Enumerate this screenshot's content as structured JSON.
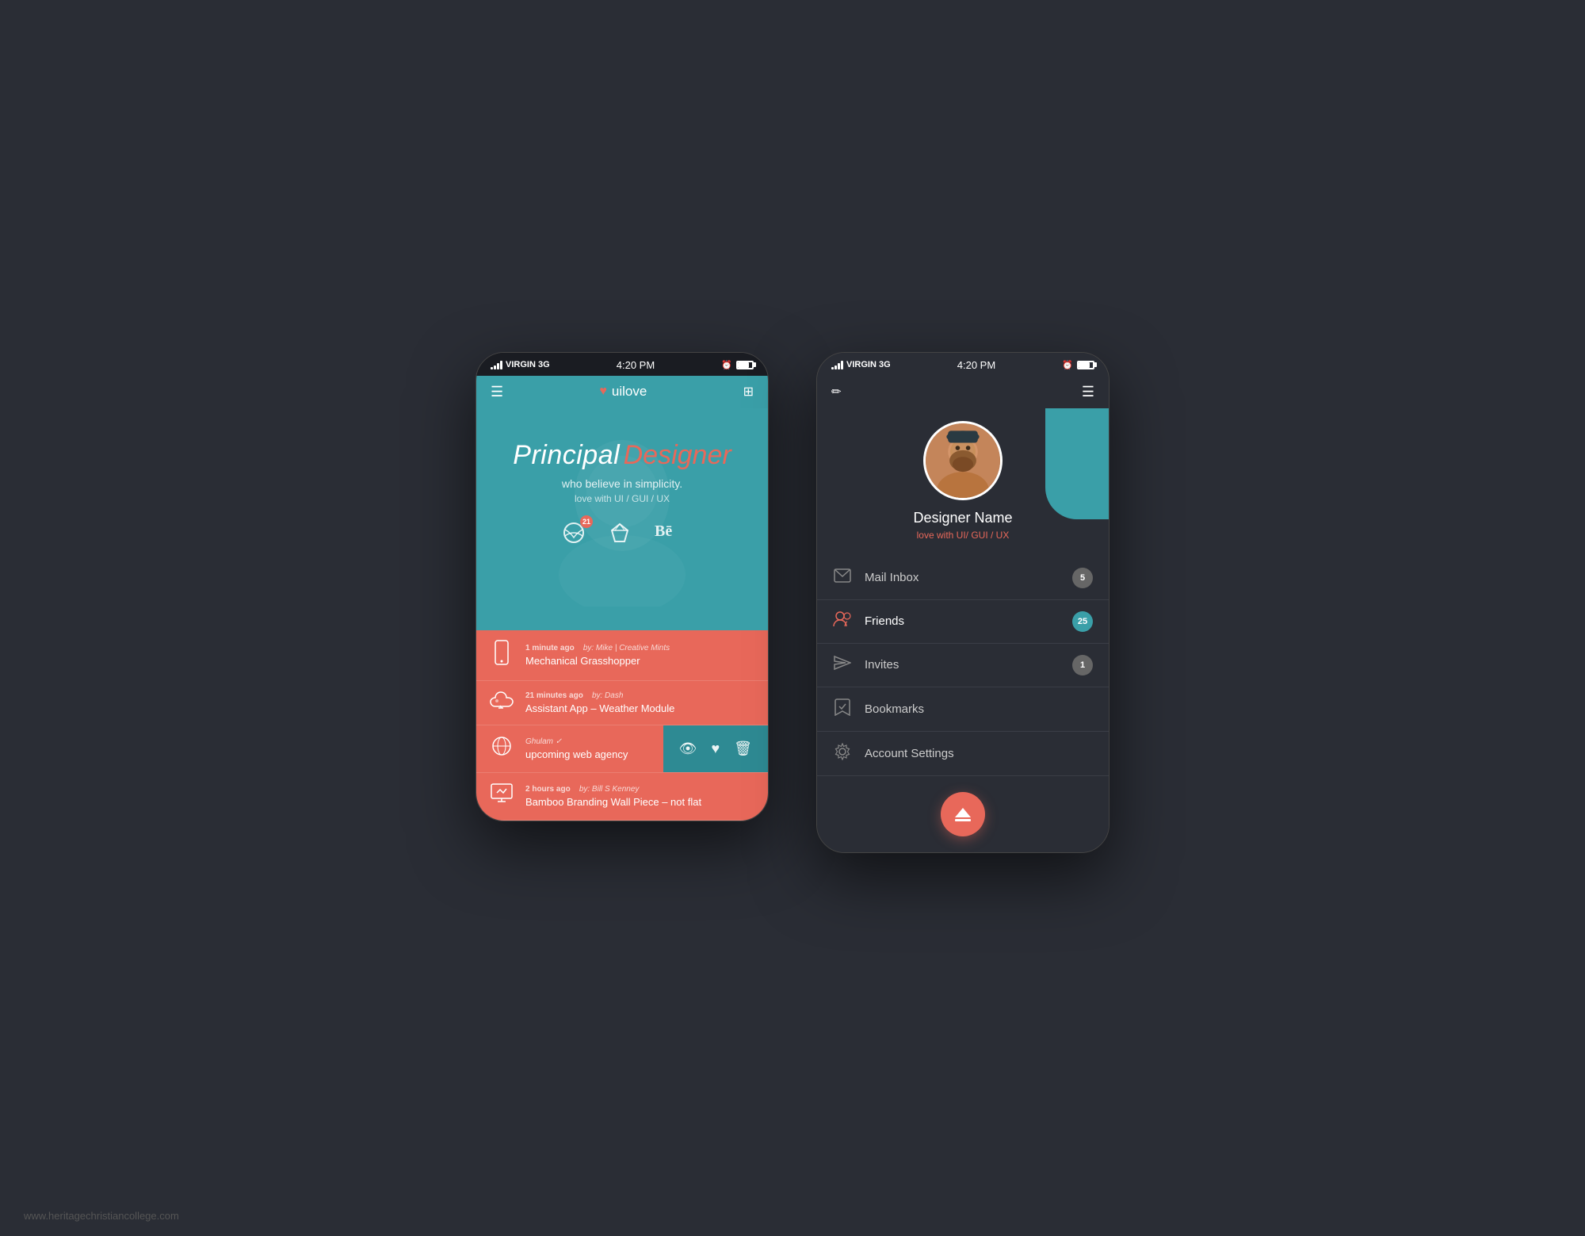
{
  "watermark": "www.heritagechristiancollege.com",
  "phone1": {
    "status_bar": {
      "carrier": "VIRGIN  3G",
      "time": "4:20 PM"
    },
    "header": {
      "menu_label": "☰",
      "logo_text": "uilove",
      "heart": "♥",
      "briefcase": "💼"
    },
    "hero": {
      "title_main": "Principal",
      "title_accent": "Designer",
      "subtitle": "who believe in simplicity.",
      "tagline": "love with UI / GUI / UX"
    },
    "social_icons": {
      "dribbble_badge": "21"
    },
    "feed_items": [
      {
        "time": "1 minute ago",
        "author": "by: Mike | Creative Mints",
        "title": "Mechanical Grasshopper",
        "icon": "phone"
      },
      {
        "time": "21 minutes ago",
        "author": "by: Dash",
        "title": "Assistant App – Weather Module",
        "icon": "cloud"
      },
      {
        "time": "",
        "author": "Ghulam ✓",
        "title": "upcoming web agency",
        "icon": "globe",
        "swipe": true
      },
      {
        "time": "2 hours ago",
        "author": "by: Bill S Kenney",
        "title": "Bamboo Branding  Wall Piece – not flat",
        "icon": "monitor"
      }
    ]
  },
  "phone2": {
    "status_bar": {
      "carrier": "VIRGIN  3G",
      "time": "4:20 PM"
    },
    "profile": {
      "name": "Designer Name",
      "tagline": "love with UI/ GUI / UX"
    },
    "menu_items": [
      {
        "id": "mail",
        "label": "Mail Inbox",
        "badge": "5",
        "badge_type": "grey",
        "icon": "mail"
      },
      {
        "id": "friends",
        "label": "Friends",
        "badge": "25",
        "badge_type": "teal",
        "icon": "friends",
        "active": true
      },
      {
        "id": "invites",
        "label": "Invites",
        "badge": "1",
        "badge_type": "grey",
        "icon": "send"
      },
      {
        "id": "bookmarks",
        "label": "Bookmarks",
        "badge": "",
        "icon": "bookmark"
      },
      {
        "id": "settings",
        "label": "Account Settings",
        "badge": "",
        "icon": "gear"
      }
    ]
  }
}
